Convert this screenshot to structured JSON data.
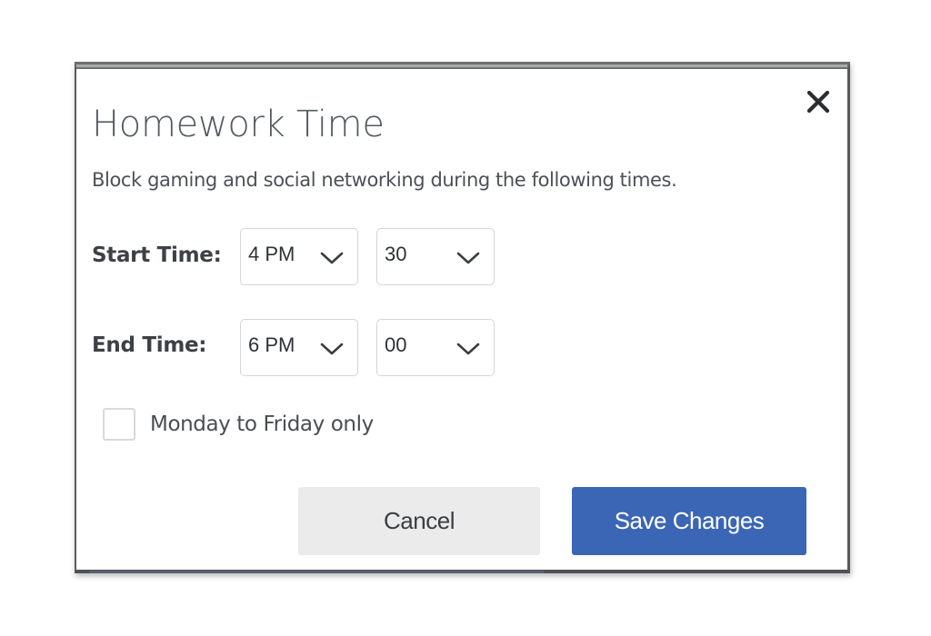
{
  "dialog": {
    "title": "Homework Time",
    "description": "Block gaming and social networking during the following times.",
    "close_icon": "close-icon"
  },
  "start_time": {
    "label": "Start Time:",
    "hour": "4 PM",
    "minute": "30"
  },
  "end_time": {
    "label": "End Time:",
    "hour": "6 PM",
    "minute": "00"
  },
  "weekday_option": {
    "label": "Monday to Friday only",
    "checked": false
  },
  "buttons": {
    "cancel_label": "Cancel",
    "save_label": "Save Changes"
  },
  "colors": {
    "primary": "#3a66b5",
    "secondary_button": "#ebebeb"
  }
}
